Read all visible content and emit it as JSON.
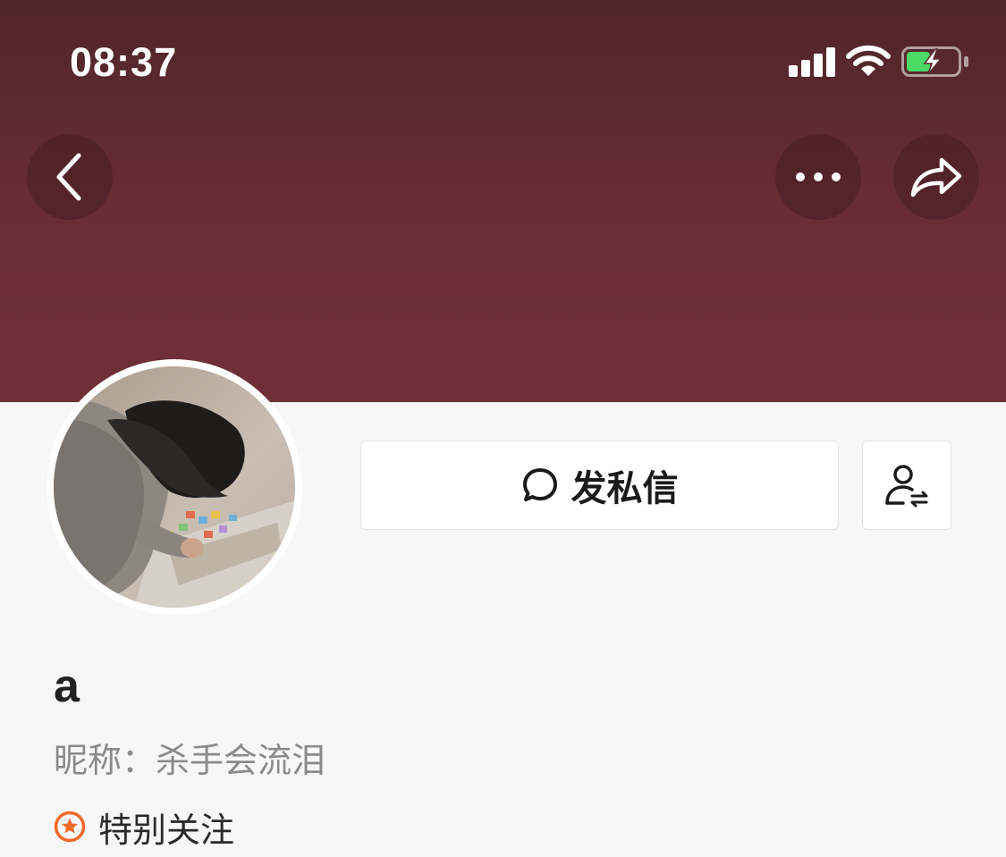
{
  "status_bar": {
    "time": "08:37",
    "icons": [
      "signal-icon",
      "wifi-icon",
      "battery-charging-icon"
    ]
  },
  "nav": {
    "back_icon": "chevron-left-icon",
    "more_icon": "more-horizontal-icon",
    "share_icon": "share-arrow-icon"
  },
  "profile": {
    "avatar": "user-avatar-photo",
    "username": "a",
    "nickname": "昵称：杀手会流泪",
    "special_follow_label": "特别关注",
    "special_follow_icon": "star-circle-icon"
  },
  "actions": {
    "dm_label": "发私信",
    "dm_icon": "chat-bubble-icon",
    "follow_icon": "user-switch-icon"
  },
  "colors": {
    "header": "#6f2f36",
    "background": "#f7f7f7",
    "accent_orange": "#f06a2a",
    "battery_green": "#4cd964"
  }
}
